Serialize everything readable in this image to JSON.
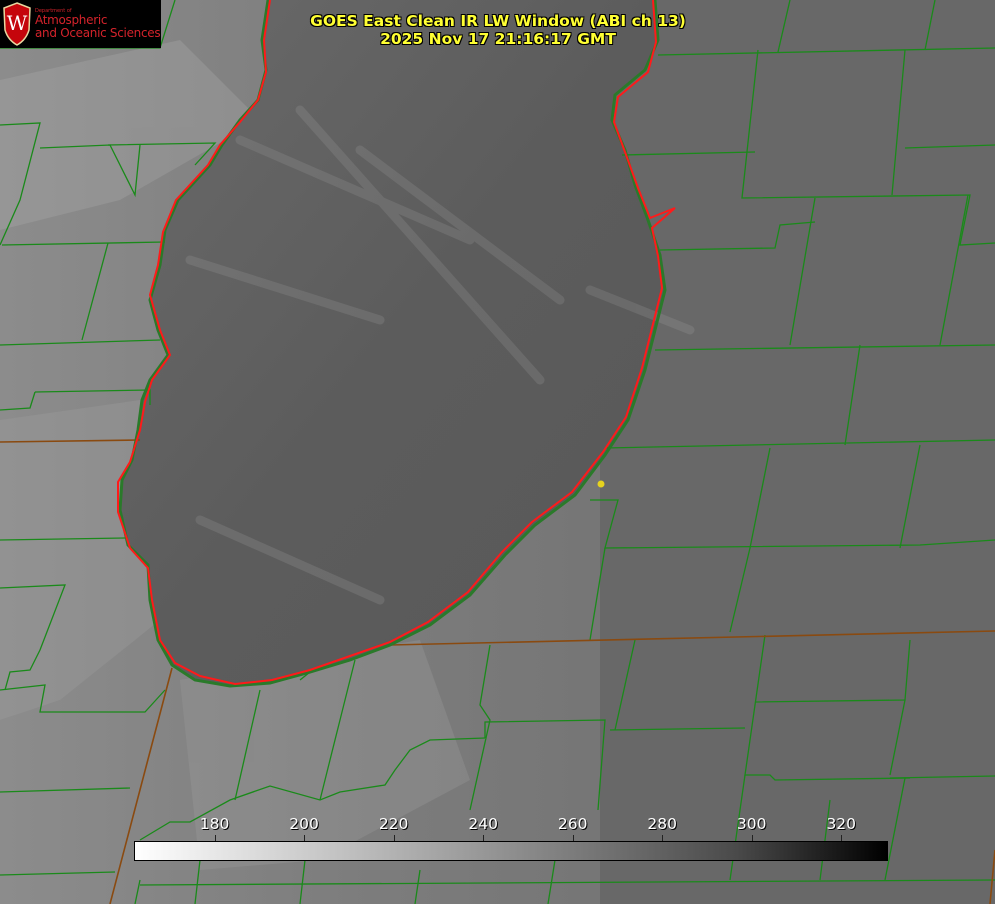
{
  "logo": {
    "department": "Department of",
    "line1": "Atmospheric",
    "line2": "and Oceanic Sciences",
    "crest_letter": "W",
    "crest_color": "#c5050c"
  },
  "title": {
    "line1": "GOES East Clean IR LW Window (ABI ch 13)",
    "line2": "2025 Nov 17 21:16:17 GMT"
  },
  "colorbar": {
    "min": 162,
    "max": 330,
    "ticks": [
      "180",
      "200",
      "220",
      "240",
      "260",
      "280",
      "300",
      "320"
    ],
    "tick_values": [
      180,
      200,
      220,
      240,
      260,
      280,
      300,
      320
    ],
    "gradient_stops": [
      "#ffffff",
      "#9a9a9a",
      "#4a4a4a",
      "#000000"
    ]
  },
  "colors": {
    "title": "#ffff33",
    "county_lines": "#1a8a1a",
    "state_lines": "#8a4a10",
    "shoreline": "#ff1a1a",
    "marker": "#e6d21e",
    "lake_fill": "#5b5b5b",
    "land_fill": "#6b6b6b"
  },
  "map": {
    "feature": "lake",
    "marker_label": ""
  }
}
